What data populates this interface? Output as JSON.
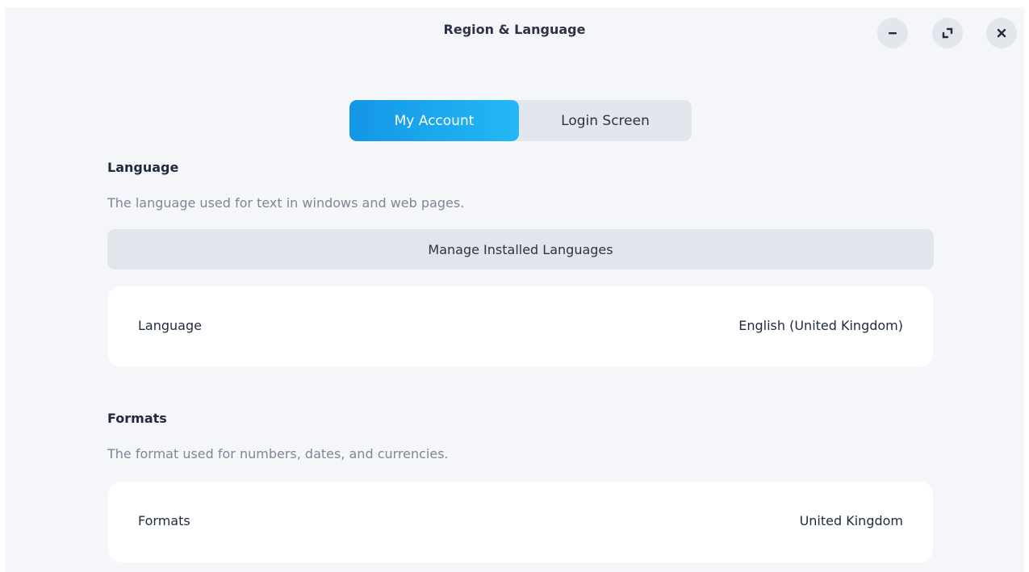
{
  "window": {
    "title": "Region & Language",
    "controls": {
      "minimize_icon": "minimize-icon",
      "maximize_icon": "maximize-icon",
      "close_icon": "close-icon"
    }
  },
  "tabs": [
    {
      "label": "My Account",
      "active": true
    },
    {
      "label": "Login Screen",
      "active": false
    }
  ],
  "language_section": {
    "heading": "Language",
    "description": "The language used for text in windows and web pages.",
    "manage_button": "Manage Installed Languages",
    "row": {
      "label": "Language",
      "value": "English (United Kingdom)"
    }
  },
  "formats_section": {
    "heading": "Formats",
    "description": "The format used for numbers, dates, and currencies.",
    "row": {
      "label": "Formats",
      "value": "United Kingdom"
    }
  },
  "colors": {
    "accent_start": "#1496e6",
    "accent_end": "#23b8f5",
    "background": "#f4f6fa",
    "card": "#ffffff"
  }
}
